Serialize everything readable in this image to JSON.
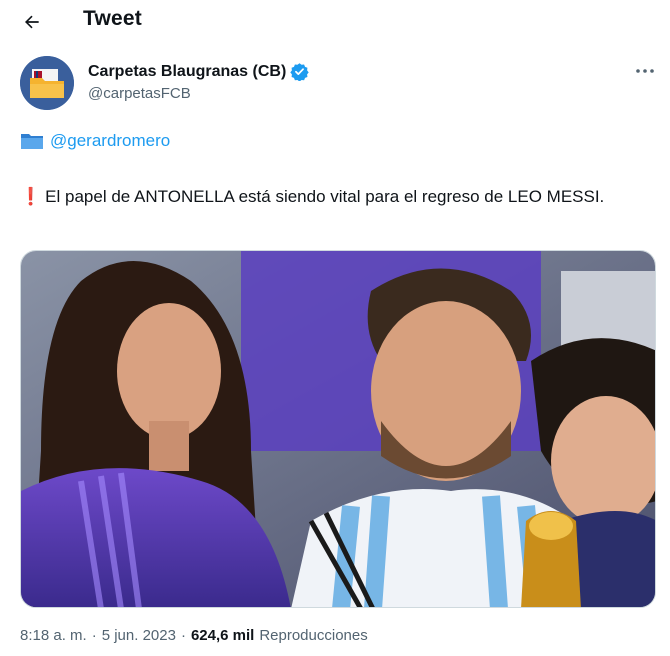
{
  "header": {
    "title": "Tweet"
  },
  "author": {
    "name": "Carpetas Blaugranas (CB)",
    "handle": "@carpetasFCB",
    "verified": true
  },
  "tweet": {
    "mention": "@gerardromero",
    "text": "El papel de ANTONELLA está siendo vital para el regreso de LEO MESSI."
  },
  "meta": {
    "time": "8:18 a. m.",
    "date": "5 jun. 2023",
    "views_count": "624,6 mil",
    "views_label": "Reproducciones",
    "separator": "·"
  },
  "colors": {
    "accent": "#1d9bf0",
    "text": "#0f1419",
    "secondary": "#536471",
    "alert": "#d9232d"
  },
  "icons": {
    "back": "arrow-left-icon",
    "verified": "verified-badge-icon",
    "more": "more-horizontal-icon",
    "folder": "folder-icon",
    "exclamation": "exclamation-icon"
  }
}
